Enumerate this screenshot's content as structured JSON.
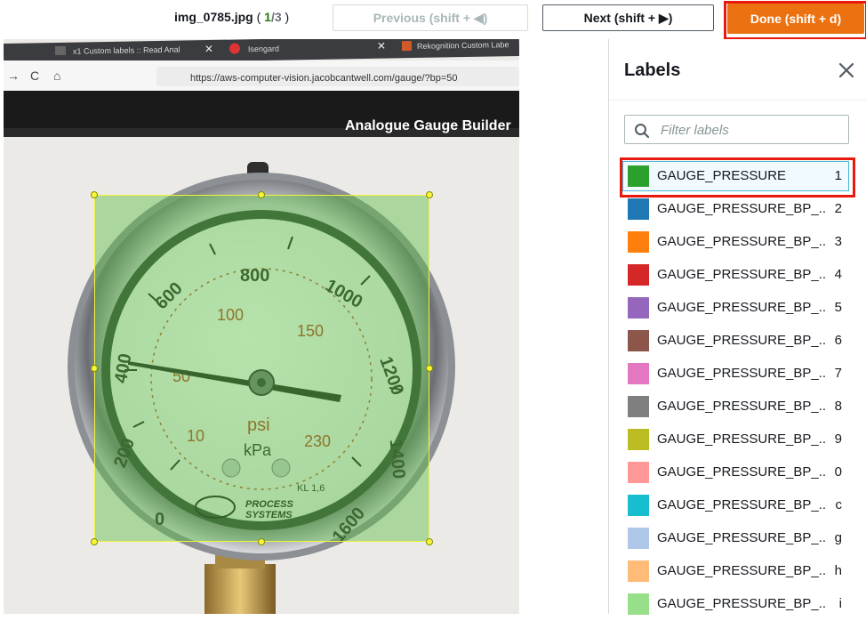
{
  "header": {
    "filename": "img_0785.jpg",
    "paren_open": " ( ",
    "current_index": "1",
    "separator": "/",
    "total": "3",
    "paren_close": " )",
    "prev_label": "Previous (shift + ◀)",
    "next_label": "Next (shift + ▶)",
    "done_label": "Done (shift + d)"
  },
  "photo": {
    "browser_tabs": [
      "x1 Custom labels :: Read Anal",
      "Isengard",
      "Rekognition Custom Labe"
    ],
    "url": "https://aws-computer-vision.jacobcantwell.com/gauge/?bp=50",
    "page_heading": "Analogue Gauge Builder",
    "gauge_outer_ticks": [
      "0",
      "200",
      "400",
      "600",
      "800",
      "1000",
      "1200",
      "1400",
      "1600"
    ],
    "gauge_inner_ticks": [
      "10",
      "50",
      "100",
      "150",
      "230"
    ],
    "gauge_unit_psi": "psi",
    "gauge_unit_kpa": "kPa",
    "gauge_class": "KL 1,6",
    "brand_line1": "PROCESS",
    "brand_line2": "SYSTEMS"
  },
  "panel": {
    "title": "Labels",
    "filter_placeholder": "Filter labels",
    "filter_value": "",
    "labels": [
      {
        "name": "GAUGE_PRESSURE",
        "key": "1",
        "color": "#2ca02c",
        "selected": true
      },
      {
        "name": "GAUGE_PRESSURE_BP_...",
        "key": "2",
        "color": "#1f77b4"
      },
      {
        "name": "GAUGE_PRESSURE_BP_...",
        "key": "3",
        "color": "#ff7f0e"
      },
      {
        "name": "GAUGE_PRESSURE_BP_...",
        "key": "4",
        "color": "#d62728"
      },
      {
        "name": "GAUGE_PRESSURE_BP_...",
        "key": "5",
        "color": "#9467bd"
      },
      {
        "name": "GAUGE_PRESSURE_BP_...",
        "key": "6",
        "color": "#8c564b"
      },
      {
        "name": "GAUGE_PRESSURE_BP_...",
        "key": "7",
        "color": "#e377c2"
      },
      {
        "name": "GAUGE_PRESSURE_BP_...",
        "key": "8",
        "color": "#7f7f7f"
      },
      {
        "name": "GAUGE_PRESSURE_BP_...",
        "key": "9",
        "color": "#bcbd22"
      },
      {
        "name": "GAUGE_PRESSURE_BP_...",
        "key": "0",
        "color": "#ff9896"
      },
      {
        "name": "GAUGE_PRESSURE_BP_...",
        "key": "c",
        "color": "#17becf"
      },
      {
        "name": "GAUGE_PRESSURE_BP_...",
        "key": "g",
        "color": "#aec7e8"
      },
      {
        "name": "GAUGE_PRESSURE_BP_...",
        "key": "h",
        "color": "#ffbb78"
      },
      {
        "name": "GAUGE_PRESSURE_BP_...",
        "key": "i",
        "color": "#98df8a"
      }
    ]
  },
  "colors": {
    "accent_orange": "#ec7211",
    "highlight_red": "#e8180c",
    "bbox_fill": "#5ebe46",
    "bbox_handle": "#f7f73a"
  },
  "icons": {
    "close": "close-icon",
    "search": "search-icon"
  }
}
